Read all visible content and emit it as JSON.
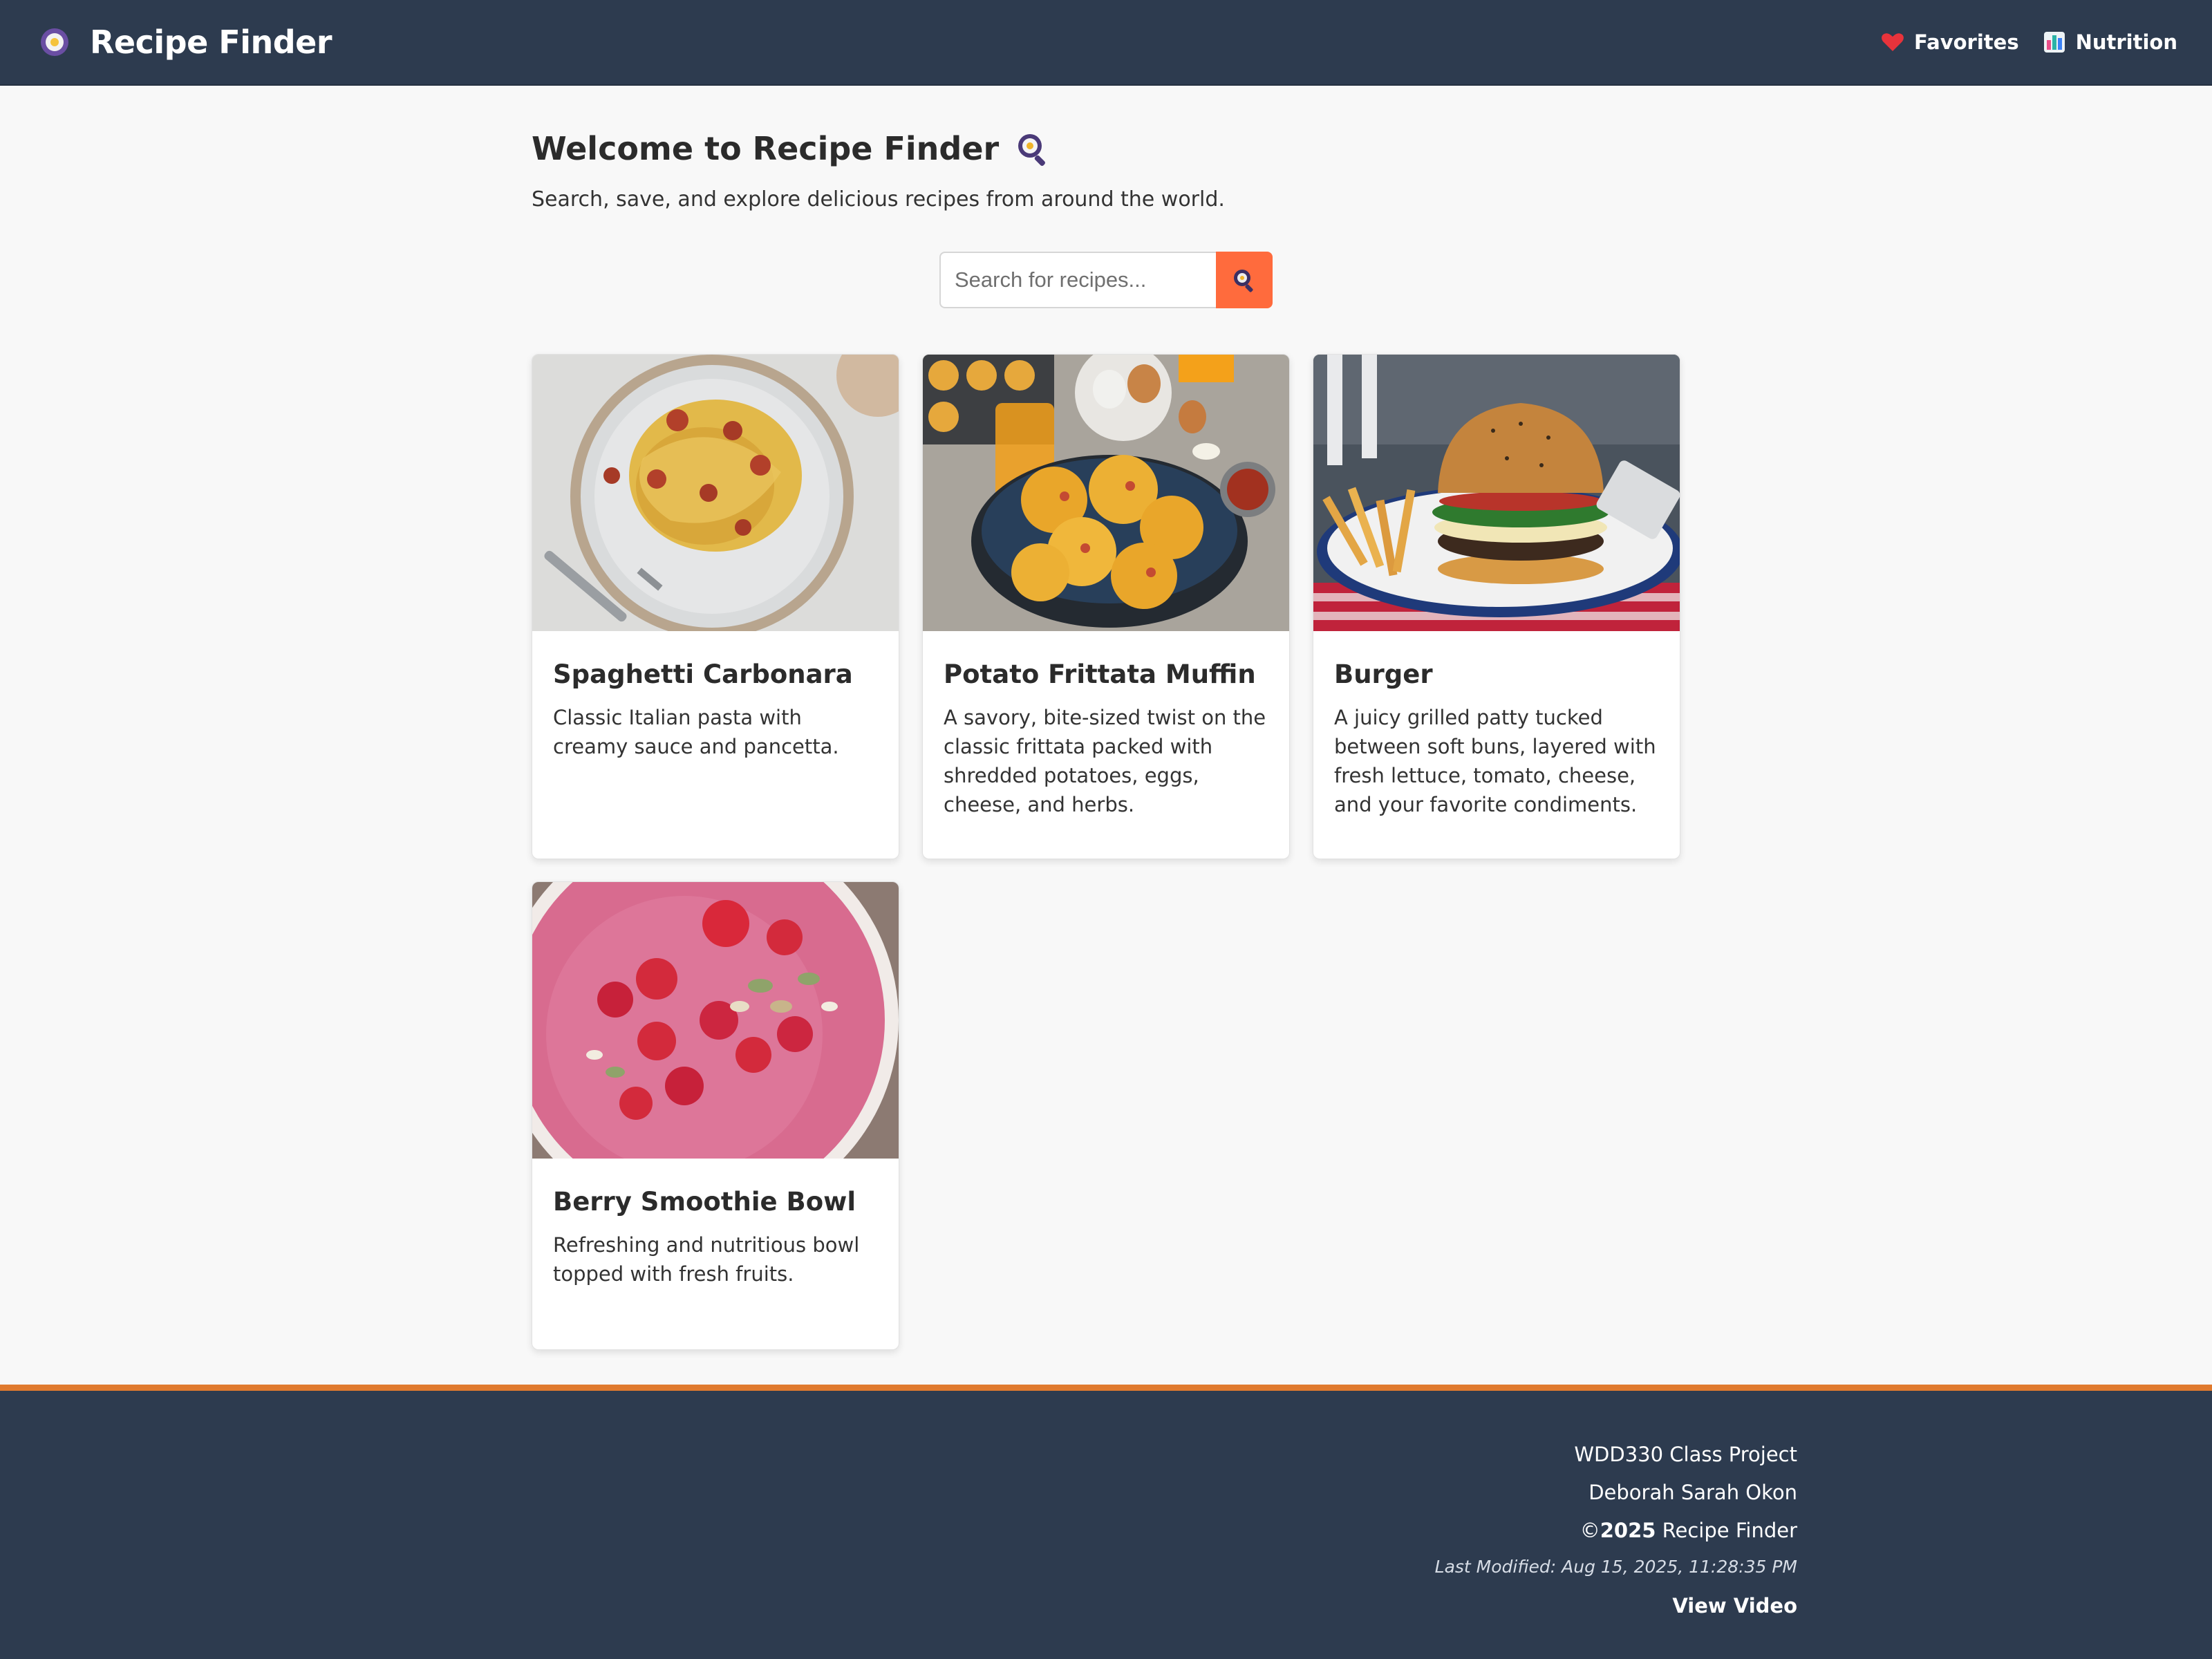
{
  "header": {
    "brand_title": "Recipe Finder",
    "nav": [
      {
        "label": "Favorites",
        "icon": "heart-icon"
      },
      {
        "label": "Nutrition",
        "icon": "bar-chart-icon"
      }
    ]
  },
  "main": {
    "welcome_title": "Welcome to Recipe Finder",
    "welcome_icon": "search-icon",
    "intro": "Search, save, and explore delicious recipes from around the world.",
    "search": {
      "placeholder": "Search for recipes...",
      "value": "",
      "button_icon": "search-icon"
    },
    "cards": [
      {
        "title": "Spaghetti Carbonara",
        "description": "Classic Italian pasta with creamy sauce and pancetta.",
        "image": "spaghetti-carbonara-photo"
      },
      {
        "title": "Potato Frittata Muffin",
        "description": "A savory, bite-sized twist on the classic frittata packed with shredded potatoes, eggs, cheese, and herbs.",
        "image": "frittata-muffin-photo"
      },
      {
        "title": "Burger",
        "description": "A juicy grilled patty tucked between soft buns, layered with fresh lettuce, tomato, cheese, and your favorite condiments.",
        "image": "burger-photo"
      },
      {
        "title": "Berry Smoothie Bowl",
        "description": "Refreshing and nutritious bowl topped with fresh fruits.",
        "image": "smoothie-bowl-photo"
      }
    ]
  },
  "footer": {
    "project": "WDD330 Class Project",
    "author": "Deborah Sarah Okon",
    "copyright_symbol": "©",
    "year": "2025",
    "copyright_name": " Recipe Finder",
    "last_modified": "Last Modified: Aug 15, 2025, 11:28:35 PM",
    "video_link": "View Video"
  },
  "colors": {
    "header_bg": "#2d3b4f",
    "accent": "#ff6b3d",
    "footer_border": "#e07a2e",
    "page_bg": "#f8f8f8"
  }
}
